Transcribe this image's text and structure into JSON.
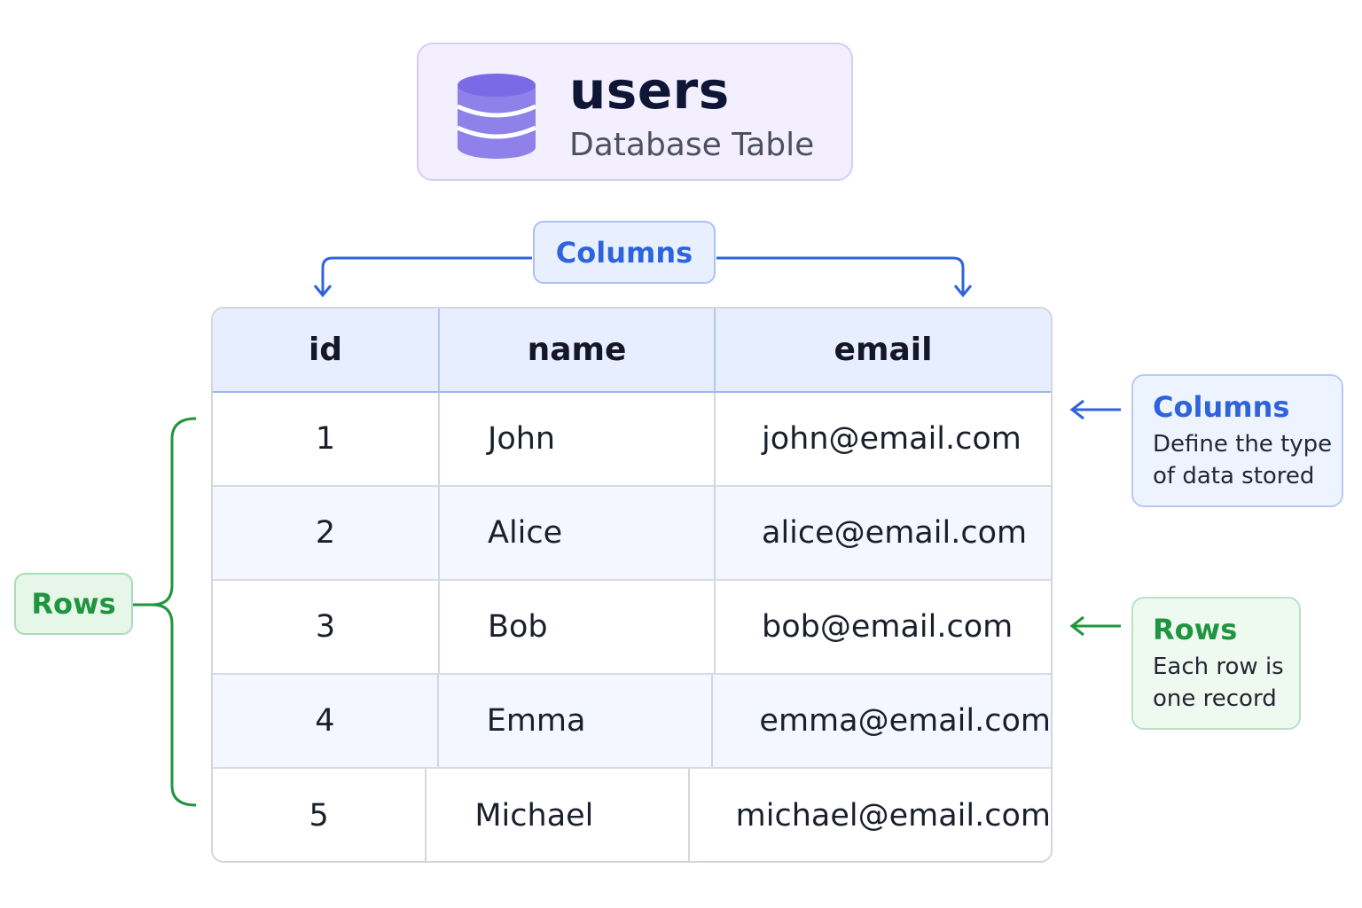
{
  "header": {
    "title": "users",
    "subtitle": "Database Table",
    "icon": "database-icon"
  },
  "columns_tag": "Columns",
  "rows_tag": "Rows",
  "table": {
    "columns": [
      "id",
      "name",
      "email"
    ],
    "rows": [
      [
        "1",
        "John",
        "john@email.com"
      ],
      [
        "2",
        "Alice",
        "alice@email.com"
      ],
      [
        "3",
        "Bob",
        "bob@email.com"
      ],
      [
        "4",
        "Emma",
        "emma@email.com"
      ],
      [
        "5",
        "Michael",
        "michael@email.com"
      ]
    ]
  },
  "callouts": {
    "columns": {
      "title": "Columns",
      "line1": "Define the type",
      "line2": "of data stored"
    },
    "rows": {
      "title": "Rows",
      "line1": "Each row is",
      "line2": "one record"
    }
  },
  "colors": {
    "blue_accent": "#2f63dc",
    "green_accent": "#20953f",
    "purple_icon": "#8b7be8"
  }
}
